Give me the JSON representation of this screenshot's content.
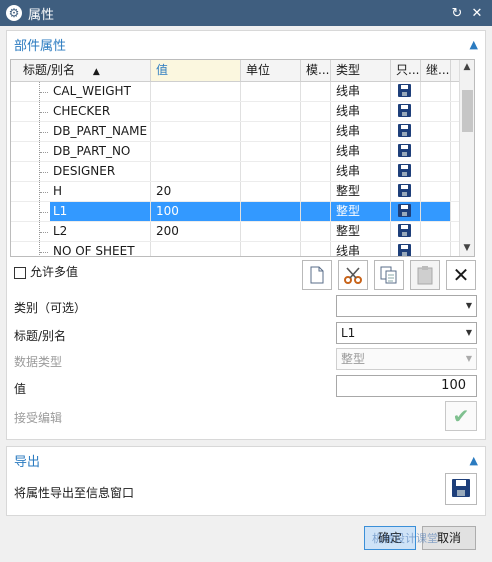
{
  "window": {
    "title": "属性"
  },
  "part_section": {
    "title": "部件属性"
  },
  "table": {
    "columns": [
      "标题/别名",
      "值",
      "单位",
      "模...",
      "类型",
      "只...",
      "继..."
    ],
    "sort_indicator": "▲",
    "rows": [
      {
        "name": "CAL_WEIGHT",
        "value": "",
        "unit": "",
        "type": "线串"
      },
      {
        "name": "CHECKER",
        "value": "",
        "unit": "",
        "type": "线串"
      },
      {
        "name": "DB_PART_NAME",
        "value": "",
        "unit": "",
        "type": "线串"
      },
      {
        "name": "DB_PART_NO",
        "value": "",
        "unit": "",
        "type": "线串"
      },
      {
        "name": "DESIGNER",
        "value": "",
        "unit": "",
        "type": "线串"
      },
      {
        "name": "H",
        "value": "20",
        "unit": "",
        "type": "整型"
      },
      {
        "name": "L1",
        "value": "100",
        "unit": "",
        "type": "整型",
        "selected": true
      },
      {
        "name": "L2",
        "value": "200",
        "unit": "",
        "type": "整型"
      },
      {
        "name": "NO OF SHEET",
        "value": "",
        "unit": "",
        "type": "线串"
      }
    ]
  },
  "allow_multiple": {
    "label": "允许多值"
  },
  "form": {
    "category_label": "类别（可选）",
    "category_value": "",
    "title_label": "标题/别名",
    "title_value": "L1",
    "datatype_label": "数据类型",
    "datatype_value": "整型",
    "value_label": "值",
    "value_value": "100",
    "accept_label": "接受编辑"
  },
  "export_section": {
    "title": "导出",
    "export_label": "将属性导出至信息窗口"
  },
  "footer": {
    "ok_label": "确定",
    "watermark": "机械设计课堂",
    "cancel_label": "取消"
  },
  "colors": {
    "titlebar": "#3f5e7f",
    "accent": "#2b7bc0",
    "selection": "#3399ff"
  }
}
